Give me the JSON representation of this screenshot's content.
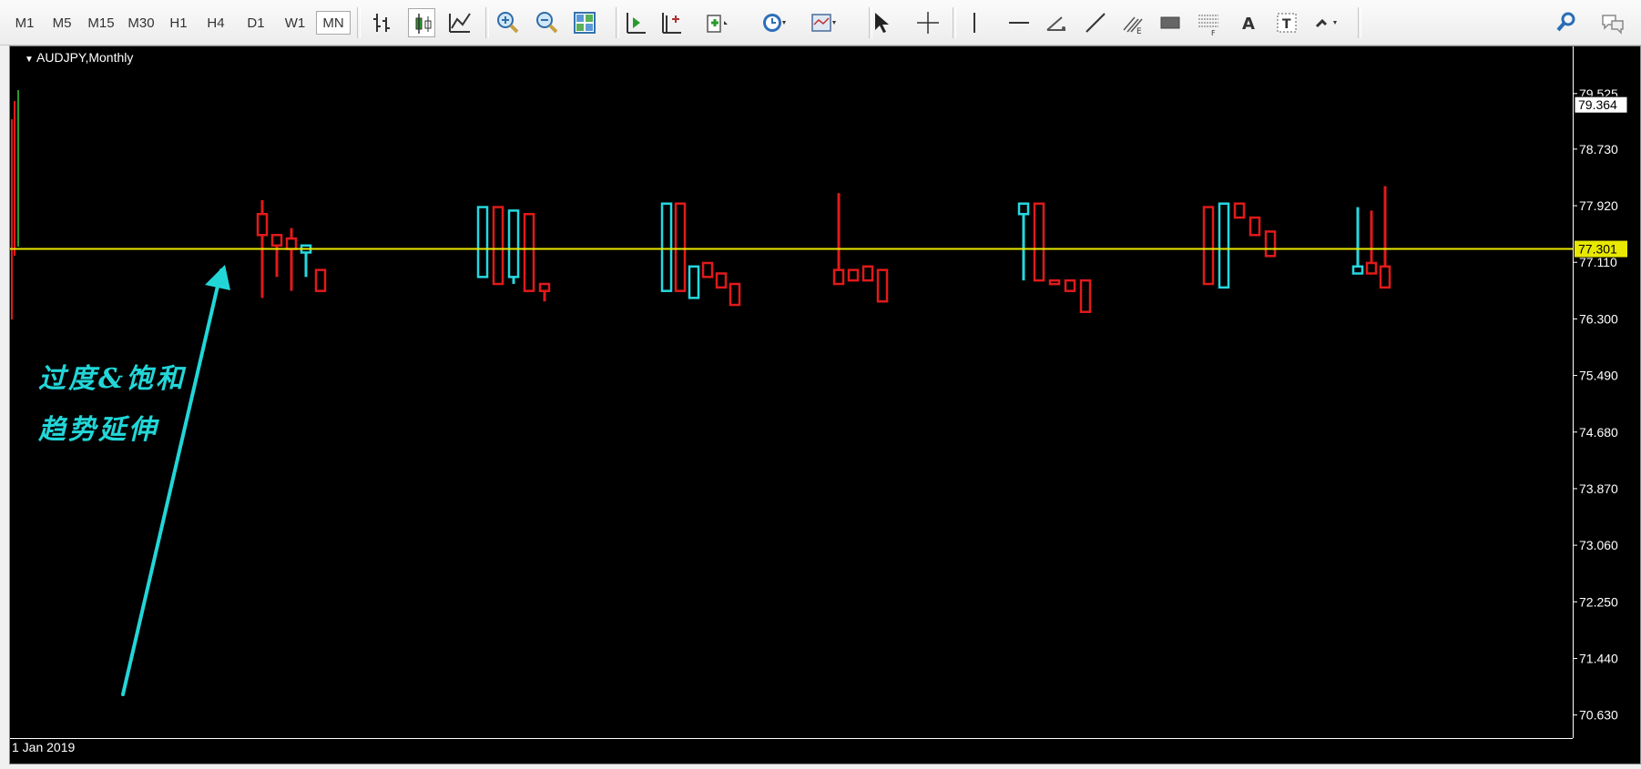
{
  "toolbar": {
    "timeframes": [
      "M1",
      "M5",
      "M15",
      "M30",
      "H1",
      "H4",
      "D1",
      "W1",
      "MN"
    ],
    "active_timeframe": "MN",
    "tools": [
      "bar-chart-icon",
      "candlestick-chart-icon",
      "line-chart-icon",
      "zoom-in-icon",
      "zoom-out-icon",
      "tile-windows-icon",
      "autoscroll-icon",
      "chart-shift-icon",
      "indicators-icon",
      "periods-icon",
      "templates-icon",
      "cursor-icon",
      "crosshair-icon",
      "vertical-line-icon",
      "horizontal-line-icon",
      "angle-trendline-icon",
      "trendline-icon",
      "fibonacci-icon",
      "rectangle-icon",
      "fibo-fan-icon",
      "text-icon",
      "text-label-icon",
      "arrows-icon",
      "search-icon",
      "chat-icon"
    ]
  },
  "chart": {
    "symbol": "AUDJPY,Monthly",
    "date_label": "1 Jan 2019",
    "current_price": "77.301",
    "top_price_box": "79.364",
    "annotation_lines": [
      "过度&饱和",
      "趋势延伸"
    ],
    "colors": {
      "background": "#000000",
      "bull": "#26d8e0",
      "bear": "#e01a1a",
      "price_line": "#e8e800",
      "annotation": "#22d6d8"
    }
  },
  "chart_data": {
    "type": "candlestick",
    "title": "AUDJPY,Monthly",
    "y_ticks": [
      "79.525",
      "78.730",
      "77.920",
      "77.110",
      "76.300",
      "75.490",
      "74.680",
      "73.870",
      "73.060",
      "72.250",
      "71.440",
      "70.630"
    ],
    "ylim": [
      70.3,
      80.2
    ],
    "current_price": 77.301,
    "clusters": [
      [
        {
          "o": 77.8,
          "h": 78.0,
          "l": 76.6,
          "c": 77.5
        },
        {
          "o": 77.5,
          "h": 77.5,
          "l": 76.9,
          "c": 77.35
        },
        {
          "o": 77.45,
          "h": 77.6,
          "l": 76.7,
          "c": 77.3
        },
        {
          "o": 77.25,
          "h": 77.3,
          "l": 76.9,
          "c": 77.35
        },
        {
          "o": 77.0,
          "h": 77.0,
          "l": 76.7,
          "c": 76.7
        }
      ],
      [
        {
          "o": 76.9,
          "h": 77.9,
          "l": 76.9,
          "c": 77.9
        },
        {
          "o": 77.9,
          "h": 77.9,
          "l": 76.8,
          "c": 76.8
        },
        {
          "o": 76.9,
          "h": 77.85,
          "l": 76.8,
          "c": 77.85
        },
        {
          "o": 77.8,
          "h": 77.8,
          "l": 76.7,
          "c": 76.7
        },
        {
          "o": 76.8,
          "h": 76.8,
          "l": 76.55,
          "c": 76.7
        }
      ],
      [
        {
          "o": 76.7,
          "h": 77.95,
          "l": 76.7,
          "c": 77.95
        },
        {
          "o": 77.95,
          "h": 77.95,
          "l": 76.7,
          "c": 76.7
        },
        {
          "o": 76.6,
          "h": 77.05,
          "l": 76.6,
          "c": 77.05
        },
        {
          "o": 77.1,
          "h": 77.1,
          "l": 76.9,
          "c": 76.9
        },
        {
          "o": 76.95,
          "h": 76.95,
          "l": 76.75,
          "c": 76.75
        },
        {
          "o": 76.8,
          "h": 76.8,
          "l": 76.5,
          "c": 76.5
        }
      ],
      [
        {
          "o": 77.0,
          "h": 78.1,
          "l": 76.8,
          "c": 76.8
        },
        {
          "o": 77.0,
          "h": 77.0,
          "l": 76.85,
          "c": 76.85
        },
        {
          "o": 77.05,
          "h": 77.05,
          "l": 76.85,
          "c": 76.85
        },
        {
          "o": 77.0,
          "h": 77.0,
          "l": 76.55,
          "c": 76.55
        }
      ],
      [
        {
          "o": 77.8,
          "h": 77.95,
          "l": 76.85,
          "c": 77.95
        },
        {
          "o": 77.95,
          "h": 77.95,
          "l": 76.85,
          "c": 76.85
        },
        {
          "o": 76.85,
          "h": 76.85,
          "l": 76.8,
          "c": 76.8
        },
        {
          "o": 76.85,
          "h": 76.85,
          "l": 76.7,
          "c": 76.7
        },
        {
          "o": 76.85,
          "h": 76.85,
          "l": 76.4,
          "c": 76.4
        }
      ],
      [
        {
          "o": 77.9,
          "h": 77.9,
          "l": 76.8,
          "c": 76.8
        },
        {
          "o": 76.75,
          "h": 77.95,
          "l": 76.75,
          "c": 77.95
        },
        {
          "o": 77.95,
          "h": 77.95,
          "l": 77.75,
          "c": 77.75
        },
        {
          "o": 77.75,
          "h": 77.75,
          "l": 77.5,
          "c": 77.5
        },
        {
          "o": 77.55,
          "h": 77.55,
          "l": 77.2,
          "c": 77.2
        }
      ],
      [
        {
          "o": 76.95,
          "h": 77.9,
          "l": 76.95,
          "c": 77.05
        },
        {
          "o": 77.1,
          "h": 77.85,
          "l": 76.95,
          "c": 76.95
        },
        {
          "o": 77.05,
          "h": 78.2,
          "l": 76.75,
          "c": 76.75
        }
      ]
    ]
  }
}
